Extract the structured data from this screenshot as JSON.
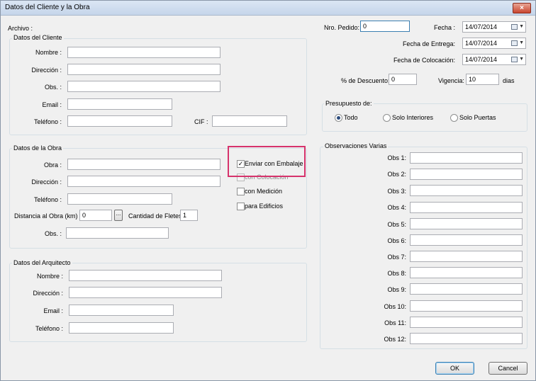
{
  "window": {
    "title": "Datos del Cliente y la Obra",
    "close_glyph": "×"
  },
  "archivo_label": "Archivo :",
  "cliente": {
    "group_title": "Datos del Cliente",
    "nombre_label": "Nombre :",
    "direccion_label": "Dirección :",
    "obs_label": "Obs. :",
    "email_label": "Email :",
    "telefono_label": "Teléfono :",
    "cif_label": "CIF :",
    "nombre": "",
    "direccion": "",
    "obs": "",
    "email": "",
    "telefono": "",
    "cif": ""
  },
  "obra": {
    "group_title": "Datos de la Obra",
    "obra_label": "Obra :",
    "direccion_label": "Dirección :",
    "telefono_label": "Teléfono :",
    "distancia_label": "Distancia al Obra (km) =",
    "distancia": "0",
    "browse_label": "...",
    "fletes_label": "Cantidad de Fletes:",
    "fletes": "1",
    "obs_label": "Obs. :",
    "checks": [
      {
        "label": "Enviar con Embalaje",
        "checked": true,
        "enabled": true
      },
      {
        "label": "con Colocación",
        "checked": false,
        "enabled": false
      },
      {
        "label": "con Medición",
        "checked": false,
        "enabled": true
      },
      {
        "label": "para Edificios",
        "checked": false,
        "enabled": true
      }
    ],
    "check_mark": "✓"
  },
  "arquitecto": {
    "group_title": "Datos del Arquitecto",
    "nombre_label": "Nombre :",
    "direccion_label": "Dirección :",
    "email_label": "Email :",
    "telefono_label": "Teléfono :"
  },
  "pedido": {
    "nro_label": "Nro. Pedido:",
    "nro": "0",
    "fecha_label": "Fecha :",
    "fecha": "14/07/2014",
    "entrega_label": "Fecha de Entrega:",
    "entrega": "14/07/2014",
    "colocacion_label": "Fecha de Colocación:",
    "colocacion": "14/07/2014",
    "descuento_label": "% de Descuento:",
    "descuento": "0",
    "vigencia_label": "Vigencia:",
    "vigencia": "10",
    "dias_label": "dias",
    "dropdown_glyph": "▼"
  },
  "presupuesto": {
    "group_title": "Presupuesto de:",
    "options": [
      "Todo",
      "Solo Interiores",
      "Solo Puertas"
    ],
    "selected": "Todo"
  },
  "observaciones": {
    "group_title": "Observaciones Varias",
    "labels": [
      "Obs 1:",
      "Obs 2:",
      "Obs 3:",
      "Obs 4:",
      "Obs 5:",
      "Obs 6:",
      "Obs 7:",
      "Obs 8:",
      "Obs 9:",
      "Obs 10:",
      "Obs 11:",
      "Obs 12:"
    ]
  },
  "buttons": {
    "ok": "OK",
    "cancel": "Cancel"
  },
  "colors": {
    "highlight": "#d6336c",
    "title_bar": "#c5d5ea"
  }
}
